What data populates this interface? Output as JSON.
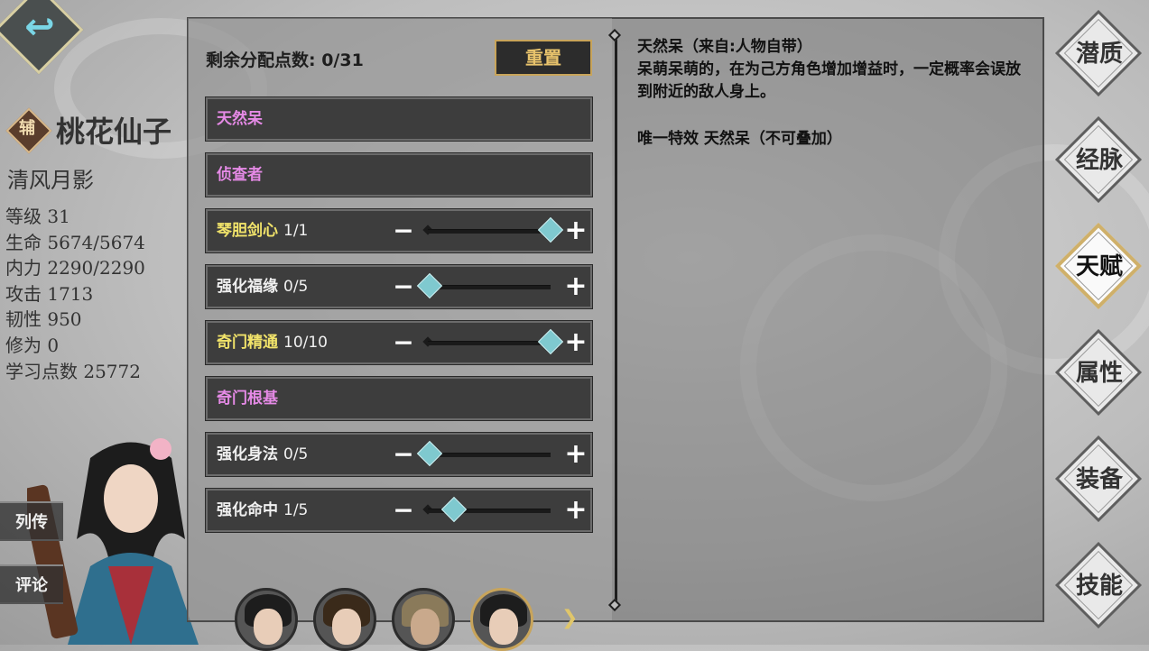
{
  "character": {
    "role_badge": "辅",
    "name": "桃花仙子",
    "title": "清风月影",
    "stats": [
      "等级 31",
      "生命 5674/5674",
      "内力 2290/2290",
      "攻击 1713",
      "韧性 950",
      "修为 0",
      "学习点数 25772"
    ]
  },
  "side_buttons": [
    "列传",
    "评论"
  ],
  "talents_panel": {
    "remaining_label": "剩余分配点数: 0/31",
    "reset_label": "重置",
    "rows": [
      {
        "name": "天然呆",
        "count": "",
        "color": "pink",
        "slider": false
      },
      {
        "name": "侦查者",
        "count": "",
        "color": "pink",
        "slider": false
      },
      {
        "name": "琴胆剑心",
        "count": "1/1",
        "color": "yellow",
        "slider": true,
        "level": 1.0
      },
      {
        "name": "强化福缘",
        "count": "0/5",
        "color": "white",
        "slider": true,
        "level": 0.0
      },
      {
        "name": "奇门精通",
        "count": "10/10",
        "color": "yellow",
        "slider": true,
        "level": 1.0
      },
      {
        "name": "奇门根基",
        "count": "",
        "color": "pink",
        "slider": false
      },
      {
        "name": "强化身法",
        "count": "0/5",
        "color": "white",
        "slider": true,
        "level": 0.0
      },
      {
        "name": "强化命中",
        "count": "1/5",
        "color": "white",
        "slider": true,
        "level": 0.2
      }
    ],
    "minus_symbol": "−",
    "plus_symbol": "+"
  },
  "description": {
    "heading": "天然呆（来自:人物自带）",
    "body": "呆萌呆萌的，在为己方角色增加增益时，一定概率会误放到附近的敌人身上。",
    "effect": "唯一特效 天然呆（不可叠加）"
  },
  "nav": [
    {
      "label": "潜质",
      "active": false
    },
    {
      "label": "经脉",
      "active": false
    },
    {
      "label": "天赋",
      "active": true
    },
    {
      "label": "属性",
      "active": false
    },
    {
      "label": "装备",
      "active": false
    },
    {
      "label": "技能",
      "active": false
    }
  ],
  "back_icon": "back-arrow-icon",
  "next_icon": "chevron-right-icon",
  "colors": {
    "pink": "#e58ae6",
    "yellow": "#f1e36a",
    "white": "#f0f0f0",
    "accent": "#c8a45a",
    "knob": "#7fc9cf"
  }
}
